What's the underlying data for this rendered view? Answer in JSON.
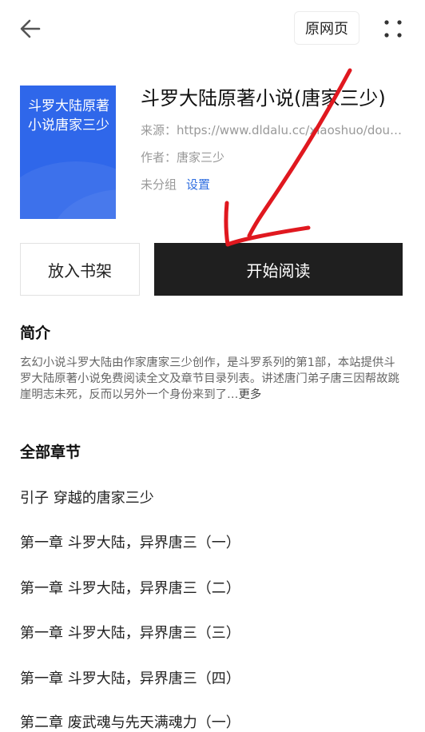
{
  "header": {
    "back_icon": "arrow-left-icon",
    "original_page_label": "原网页",
    "more_icon": "more-dots-icon"
  },
  "book": {
    "cover_title": "斗罗大陆原著小说唐家三少",
    "cover_color": "#2f67ea",
    "title": "斗罗大陆原著小说(唐家三少)",
    "source": "来源：https://www.dldalu.cc/xiaoshuo/douluodalu/",
    "author": "作者：唐家三少",
    "group": "未分组",
    "settings_label": "设置"
  },
  "actions": {
    "add_to_shelf": "放入书架",
    "start_reading": "开始阅读"
  },
  "intro": {
    "heading": "简介",
    "text": "玄幻小说斗罗大陆由作家唐家三少创作，是斗罗系列的第1部，本站提供斗罗大陆原著小说免费阅读全文及章节目录列表。讲述唐门弟子唐三因帮故跳崖明志未死，反而以另外一个身份来到了…",
    "more_label": "更多"
  },
  "chapters": {
    "heading": "全部章节",
    "items": [
      "引子 穿越的唐家三少",
      "第一章 斗罗大陆，异界唐三（一）",
      "第一章 斗罗大陆，异界唐三（二）",
      "第一章 斗罗大陆，异界唐三（三）",
      "第一章 斗罗大陆，异界唐三（四）",
      "第二章 废武魂与先天满魂力（一）"
    ]
  },
  "annotation": {
    "color": "#e0181f"
  }
}
